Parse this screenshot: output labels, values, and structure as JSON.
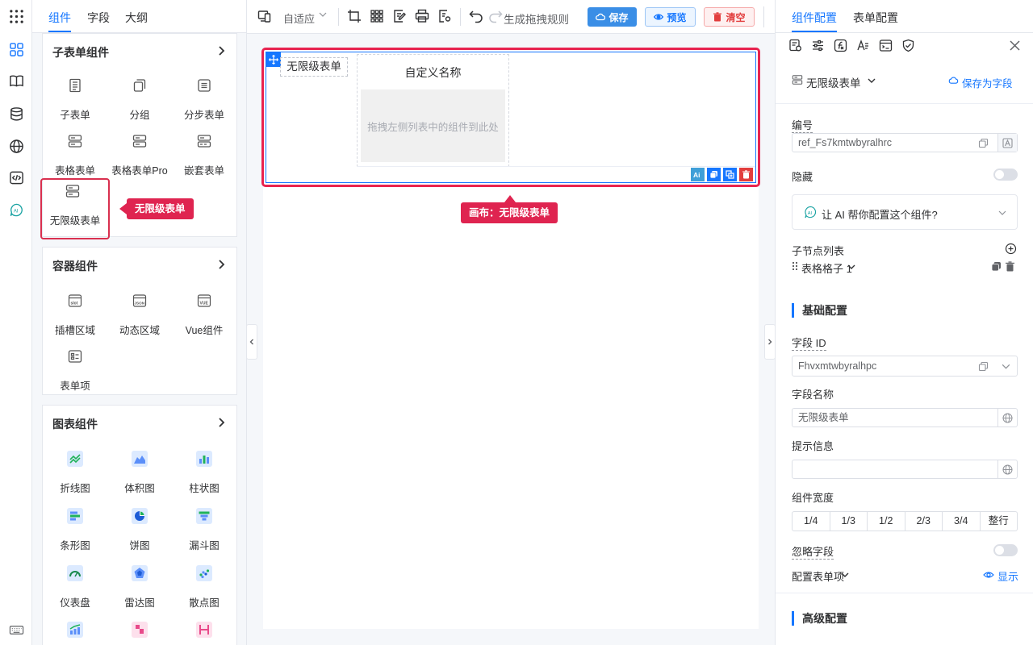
{
  "left_tabs": [
    "组件",
    "字段",
    "大纲"
  ],
  "rail_icons": [
    "apps-grid-icon",
    "book-icon",
    "database-icon",
    "globe-icon",
    "code-icon",
    "ai-icon",
    "keyboard-icon"
  ],
  "groups": {
    "subform": {
      "title": "子表单组件",
      "items": [
        "子表单",
        "分组",
        "分步表单",
        "表格表单",
        "表格表单Pro",
        "嵌套表单",
        "无限级表单"
      ]
    },
    "container": {
      "title": "容器组件",
      "items": [
        "插槽区域",
        "动态区域",
        "Vue组件",
        "表单项"
      ]
    },
    "chart": {
      "title": "图表组件",
      "items": [
        "折线图",
        "体积图",
        "柱状图",
        "条形图",
        "饼图",
        "漏斗图",
        "仪表盘",
        "雷达图",
        "散点图"
      ]
    }
  },
  "callouts": {
    "component": "无限级表单",
    "canvas": "画布：无限级表单"
  },
  "toolbar": {
    "adaptive": "自适应",
    "generate_rule": "生成拖拽规则",
    "save": "保存",
    "preview": "预览",
    "clear": "清空"
  },
  "canvas": {
    "component_tag": "无限级表单",
    "cell_title": "自定义名称",
    "drop_hint": "拖拽左侧列表中的组件到此处"
  },
  "right_tabs": [
    "组件配置",
    "表单配置"
  ],
  "right": {
    "component_type": "无限级表单",
    "save_as_field": "保存为字段",
    "number_label": "编号",
    "number_value": "ref_Fs7kmtwbyralhrc",
    "hidden_label": "隐藏",
    "ai_prompt": "让 AI 帮你配置这个组件?",
    "children_label": "子节点列表",
    "child_item": "表格格子 1",
    "basic_section": "基础配置",
    "field_id_label": "字段 ID",
    "field_id_value": "Fhvxmtwbyralhpc",
    "field_name_label": "字段名称",
    "field_name_value": "无限级表单",
    "hint_label": "提示信息",
    "hint_value": "",
    "width_label": "组件宽度",
    "width_options": [
      "1/4",
      "1/3",
      "1/2",
      "2/3",
      "3/4",
      "整行"
    ],
    "ignore_label": "忽略字段",
    "form_item_label": "配置表单项",
    "show_label": "显示",
    "advanced_section": "高级配置"
  },
  "colors": {
    "accent": "#1677ff",
    "highlight": "#e8234f",
    "danger": "#e23d3d"
  }
}
